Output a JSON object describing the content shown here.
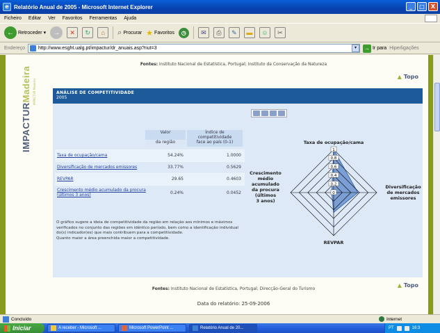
{
  "window": {
    "title": "Relatório Anual de 2005 - Microsoft Internet Explorer",
    "controls": [
      "_",
      "□",
      "X"
    ]
  },
  "menu": [
    "Ficheiro",
    "Editar",
    "Ver",
    "Favoritos",
    "Ferramentas",
    "Ajuda"
  ],
  "toolbar": {
    "back": "Retroceder",
    "search": "Procurar",
    "favorites": "Favoritos"
  },
  "address": {
    "label": "Endereço",
    "url": "http://www.esght.ualg.pt/impactur/dr_anuais.asp?nut=3",
    "go": "Ir para",
    "links": "Hiperligações"
  },
  "brand": {
    "word1": "IMPACTUR",
    "word2": "Madeira",
    "sub": "IMPACTUR Madeira"
  },
  "sources_top": {
    "label": "Fontes:",
    "text": "Instituto Nacional de Estatística, Portugal; Instituto da Conservação da Natureza"
  },
  "topo": "Topo",
  "section": {
    "title": "ANÁLISE DE COMPETITIVIDADE",
    "year": "2005"
  },
  "table": {
    "col_value": [
      "Valor",
      "da região"
    ],
    "col_index": [
      "Índice de",
      "competitividade",
      "face ao país (0-1)"
    ],
    "rows": [
      {
        "label": "Taxa de ocupação/cama",
        "value": "54.24%",
        "index": "1.0000"
      },
      {
        "label": "Diversificação de mercados emissores",
        "value": "33.77%",
        "index": "0.5629"
      },
      {
        "label": "REVPAR",
        "value": "29.65",
        "index": "0.4603"
      },
      {
        "label": "Crescimento médio acumulado da procura (últimos 3 anos)",
        "value": "0.24%",
        "index": "0.0452"
      }
    ]
  },
  "note": {
    "text": "O gráfico sugere a ideia de competitividade da região em relação aos mínimos e máximos verificados no conjunto das regiões em idêntico período, bem como a identificação individual do(s) indicador(es) que mais contribuem para a competitividade.",
    "note2": "Quanto maior a área preenchida maior a competitividade."
  },
  "chart_data": {
    "type": "radar",
    "axes": [
      "Taxa de ocupação/cama",
      "Diversificação de mercados emissores",
      "REVPAR",
      "Crescimento médio acumulado da procura (últimos 3 anos)"
    ],
    "axis_labels": {
      "top": "Taxa de ocupação/cama",
      "right": [
        "Diversificação",
        "de mercados",
        "emissores"
      ],
      "bottom": "REVPAR",
      "left": [
        "Crescimento",
        "médio",
        "acumulado",
        "da procura",
        "(últimos",
        "3 anos)"
      ]
    },
    "values": [
      1.0,
      0.5629,
      0.4603,
      0.0452
    ],
    "ticks": [
      "0",
      "0,2",
      "0,4",
      "0,6",
      "0,8",
      "1"
    ],
    "range": [
      0,
      1
    ],
    "fill_color": "#5a86c8",
    "grid_color": "#000000"
  },
  "sources_bottom": {
    "label": "Fontes:",
    "text": "Instituto Nacional de Estatística, Portugal; Direcção-Geral do Turismo"
  },
  "report_date": "Data do relatório: 25-09-2006",
  "status": {
    "left": "Concluído",
    "zone": "Internet"
  },
  "taskbar": {
    "start": "Iniciar",
    "tasks": [
      "A receber - Microsoft ...",
      "Microsoft PowerPoint ...",
      "Relatório Anual de 20..."
    ],
    "lang": "PT",
    "clock": "16:3"
  }
}
